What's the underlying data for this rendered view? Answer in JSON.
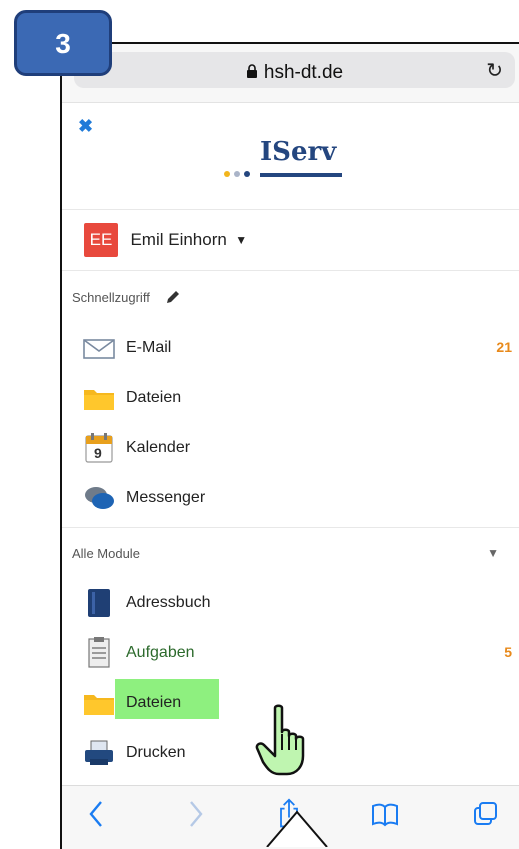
{
  "step_badge": "3",
  "browser": {
    "url": "hsh-dt.de"
  },
  "app": {
    "logo_text": "IServ"
  },
  "user": {
    "initials": "EE",
    "name": "Emil Einhorn"
  },
  "quick_access": {
    "title": "Schnellzugriff",
    "items": [
      {
        "label": "E-Mail",
        "icon": "mail-icon",
        "count": "21"
      },
      {
        "label": "Dateien",
        "icon": "folder-icon",
        "count": ""
      },
      {
        "label": "Kalender",
        "icon": "calendar-icon",
        "count": ""
      },
      {
        "label": "Messenger",
        "icon": "messenger-icon",
        "count": ""
      }
    ]
  },
  "all_modules": {
    "title": "Alle Module",
    "items": [
      {
        "label": "Adressbuch",
        "icon": "addressbook-icon",
        "count": ""
      },
      {
        "label": "Aufgaben",
        "icon": "tasks-icon",
        "count": "5"
      },
      {
        "label": "Dateien",
        "icon": "folder-icon",
        "count": ""
      },
      {
        "label": "Drucken",
        "icon": "printer-icon",
        "count": ""
      }
    ]
  },
  "calendar_icon_day": "9",
  "colors": {
    "accent": "#e8891a",
    "brand": "#24467f",
    "highlight": "#8ef07f",
    "badge": "#3b69b4"
  }
}
